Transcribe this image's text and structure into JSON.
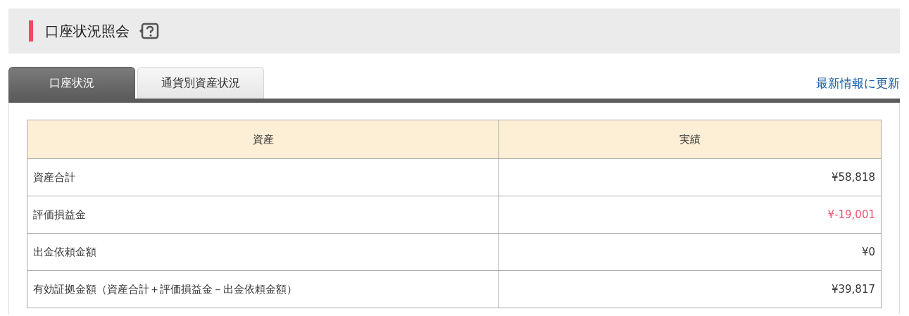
{
  "header": {
    "title": "口座状況照会"
  },
  "tabs": [
    {
      "label": "口座状況",
      "selected": true
    },
    {
      "label": "通貨別資産状況",
      "selected": false
    }
  ],
  "refresh_link": "最新情報に更新",
  "table": {
    "columns": [
      "資産",
      "実績"
    ],
    "rows": [
      {
        "label": "資産合計",
        "value": "¥58,818",
        "color": "#333333"
      },
      {
        "label": "評価損益金",
        "value": "¥-19,001",
        "color": "#f0506e"
      },
      {
        "label": "出金依頼金額",
        "value": "¥0",
        "color": "#333333"
      },
      {
        "label": "有効証拠金額（資産合計＋評価損益金－出金依頼金額）",
        "value": "¥39,817",
        "color": "#333333"
      }
    ]
  }
}
